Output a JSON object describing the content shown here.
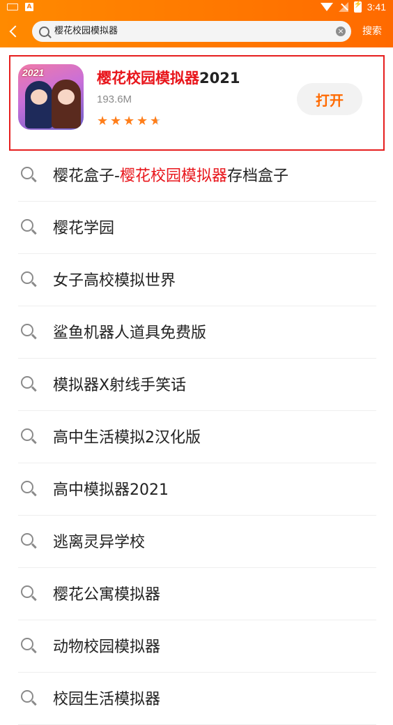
{
  "status_bar": {
    "time": "3:41",
    "notification_letter": "A"
  },
  "search": {
    "query": "樱花校园模拟器",
    "clear_label": "×",
    "submit_label": "搜索"
  },
  "result_card": {
    "title_highlight": "樱花校园模拟器",
    "title_suffix": "2021",
    "icon_year": "2021",
    "size": "193.6M",
    "rating": 4.5,
    "open_label": "打开"
  },
  "suggestions": [
    {
      "pre": "樱花盒子-",
      "hl": "樱花校园模拟器",
      "post": "存档盒子"
    },
    {
      "pre": "樱花学园",
      "hl": "",
      "post": ""
    },
    {
      "pre": "女子高校模拟世界",
      "hl": "",
      "post": ""
    },
    {
      "pre": "鲨鱼机器人道具免费版",
      "hl": "",
      "post": ""
    },
    {
      "pre": "模拟器X射线手笑话",
      "hl": "",
      "post": ""
    },
    {
      "pre": "高中生活模拟2汉化版",
      "hl": "",
      "post": ""
    },
    {
      "pre": "高中模拟器2021",
      "hl": "",
      "post": ""
    },
    {
      "pre": "逃离灵异学校",
      "hl": "",
      "post": ""
    },
    {
      "pre": "樱花公寓模拟器",
      "hl": "",
      "post": ""
    },
    {
      "pre": "动物校园模拟器",
      "hl": "",
      "post": ""
    },
    {
      "pre": "校园生活模拟器",
      "hl": "",
      "post": ""
    }
  ],
  "colors": {
    "accent": "#ff7000",
    "highlight": "#e8151b",
    "star": "#ff7e1a"
  }
}
